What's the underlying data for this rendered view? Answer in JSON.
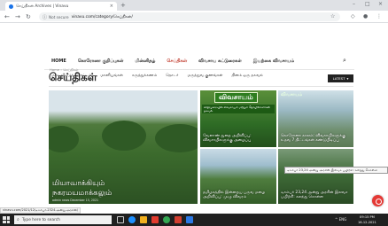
{
  "browser": {
    "tab_title": "செய்திகள் Archives | Vinavu",
    "tab_close": "×",
    "new_tab": "+",
    "nav": {
      "back": "←",
      "forward": "→",
      "reload": "↻"
    },
    "not_secure": "Not secure",
    "url": "vinavu.com/category/செய்திகள்/",
    "window": {
      "minimize": "–",
      "maximize": "□",
      "close": "×"
    }
  },
  "site": {
    "nav_primary": [
      "HOME",
      "கொரோனா குறிப்புகள்",
      "மின்னிதழ்",
      "செய்திகள்",
      "விவசாய கட்டுரைகள்",
      "இயற்கை விவசாயம்"
    ],
    "nav_primary_active_index": 3,
    "nav_secondary": [
      "மாடி வீட்டுத் தோட்டம்",
      "மானியங்கள்",
      "கருத்துக்கணம்",
      "தொடர்",
      "மருத்துவ குணங்கள்",
      "தினம் ஒரு தகவல்"
    ],
    "search_icon": "search-icon",
    "breadcrumb": "Home › செய்திகள்",
    "page_title": "செய்திகள்",
    "sort_label": "LATEST",
    "sort_caret": "▾",
    "accent_color": "#c0392b"
  },
  "articles": {
    "featured": {
      "title_line1": "மியாவாக்கியும்",
      "title_line2": "நகரமயமாக்கலும்",
      "meta": "admin news   December 15, 2021"
    },
    "card2": {
      "banner": "விவசாயம்",
      "sub": "விதிமுறையில் விவசாயம் மற்றும் தொழிலாளர்கள் தகவல்",
      "caption": "வேளாண் துறை அறிவிப்பு: விவசாயிகளுக்கு அழைப்பு"
    },
    "card3": {
      "tag": "விவசாயம்",
      "caption": "கொரோனா காலம்: விவசாயிகளுக்கு உதவ 7 திட்டங்கள் கண்டுபிடிப்பு"
    },
    "card4": {
      "caption": "தமிழகத்தில் இன்றைய பருவ மழை அறிவிப்பு: முழு விவரம்"
    },
    "card5": {
      "caption": "டிசம்பர் 23,24 அன்று அரசின் இலவச பயிற்சி: கலந்து கொள்ள"
    },
    "tooltip": "டிசம்பர் 23,24 அன்று அரசின் இலவச பயிற்சி: கலந்து கொள்ள"
  },
  "status_bar": "vinavu.com/2021/12/டிசம்பர்-2324-அன்று-அரசின்/",
  "taskbar": {
    "search_placeholder": "Type here to search",
    "tray_text": "^  ENG",
    "time": "09:15 PM",
    "date": "16-12-2021"
  }
}
